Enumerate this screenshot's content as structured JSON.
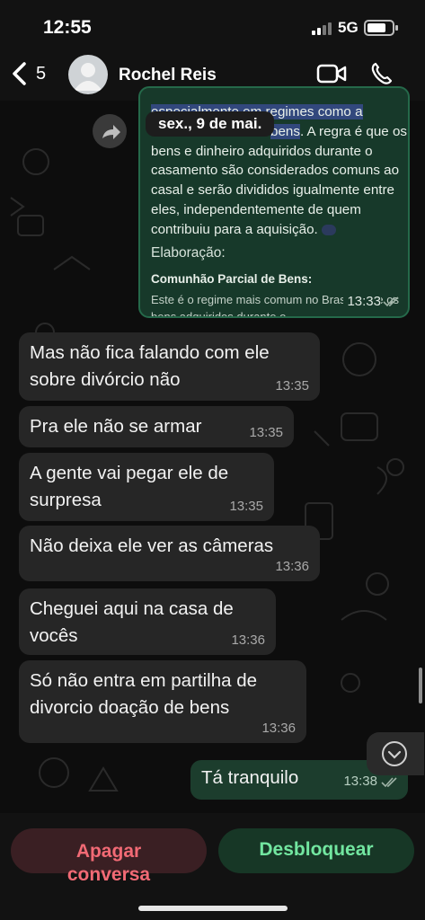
{
  "status_bar": {
    "time": "12:55",
    "network": "5G"
  },
  "header": {
    "back_count": "5",
    "contact_name": "Rochel Reis"
  },
  "forwarded": {
    "line1_highlight": "especialmente em regimes como a",
    "line2_highlight": "bens",
    "line2_rest": ". A regra é",
    "body": "que os bens e dinheiro adquiridos durante o casamento são considerados comuns ao casal e serão divididos igualmente entre eles, independentemente de quem contribuiu para a aquisição.",
    "elab_label": "Elaboração:",
    "sub_title": "Comunhão Parcial de Bens:",
    "small_text": "Este é o regime mais comum no Brasil, onde os bens adquiridos durante o",
    "time": "13:33",
    "date_pill": "sex., 9 de mai."
  },
  "messages": [
    {
      "text": "Mas não fica falando com ele\nsobre divórcio não",
      "time": "13:35"
    },
    {
      "text": "Pra ele não se armar",
      "time": "13:35"
    },
    {
      "text": "A gente vai pegar ele de\nsurpresa",
      "time": "13:35"
    },
    {
      "text": "Não deixa ele ver as câmeras",
      "time": "13:36"
    },
    {
      "text": "Cheguei aqui na casa de\nvocês",
      "time": "13:36"
    },
    {
      "text": "Só não entra em partilha de\ndivorcio doação de bens",
      "time": "13:36"
    }
  ],
  "outgoing": {
    "text": "Tá tranquilo",
    "time": "13:38"
  },
  "actions": {
    "delete_label": "Apagar\nconversa",
    "unblock_label": "Desbloquear"
  },
  "colors": {
    "accent_green": "#72e6a0",
    "danger_red": "#f26a75"
  }
}
